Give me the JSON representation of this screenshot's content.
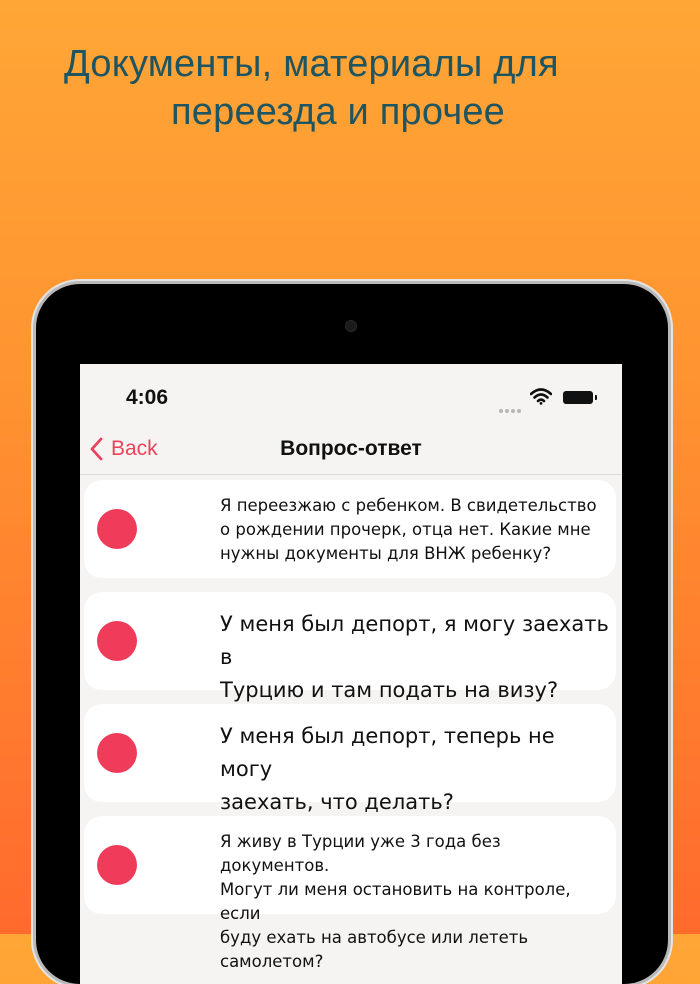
{
  "headline": {
    "line1": "Документы, материалы для",
    "line2": "переезда и прочее"
  },
  "status_bar": {
    "time": "4:06",
    "icons": [
      "cellular-icon",
      "wifi-icon",
      "battery-icon"
    ]
  },
  "nav": {
    "back_label": "Back",
    "title": "Вопрос-ответ"
  },
  "questions": [
    {
      "lines": [
        "Я переезжаю с ребенком. В свидетельство",
        "о рождении прочерк, отца нет. Какие мне",
        "нужны документы для ВНЖ ребенку?"
      ]
    },
    {
      "lines": [
        "У меня был депорт, я могу заехать в",
        "Турцию и там подать на визу?"
      ]
    },
    {
      "lines": [
        "У меня был депорт, теперь не могу",
        "заехать, что делать?"
      ]
    },
    {
      "lines": [
        "Я живу в Турции уже 3 года без документов.",
        "Могут ли меня остановить на контроле, если",
        "буду ехать на автобусе или лететь самолетом?"
      ]
    }
  ],
  "colors": {
    "accent": "#e8435a",
    "dot": "#f13b5a",
    "headline": "#1f5560",
    "background_top": "#ffa636",
    "background_bottom": "#ff6a2d"
  }
}
